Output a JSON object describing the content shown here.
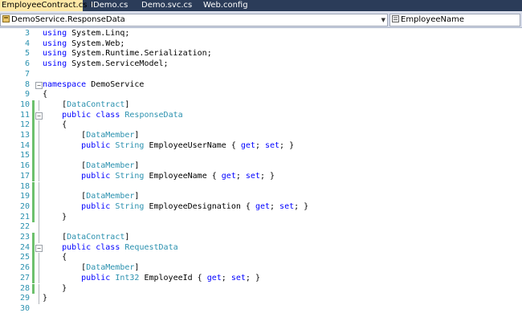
{
  "tabs": [
    {
      "label": "EmployeeContract.cs",
      "active": true,
      "closable": true
    },
    {
      "label": "IDemo.cs"
    },
    {
      "label": "Demo.svc.cs"
    },
    {
      "label": "Web.config"
    }
  ],
  "navbar": {
    "type_selector": {
      "value": "DemoService.ResponseData",
      "icon": "class-icon"
    },
    "member_selector": {
      "value": "EmployeeName",
      "icon": "property-icon"
    }
  },
  "colors": {
    "keyword": "#0000ff",
    "type": "#2b91af",
    "line_number": "#2b91af",
    "change_saved": "#6cc06c"
  },
  "code_lines": [
    {
      "num": "3",
      "tokens": [
        {
          "t": "using",
          "c": "kw"
        },
        {
          "t": " System.Linq;",
          "c": "pl"
        }
      ]
    },
    {
      "num": "4",
      "tokens": [
        {
          "t": "using",
          "c": "kw"
        },
        {
          "t": " System.Web;",
          "c": "pl"
        }
      ]
    },
    {
      "num": "5",
      "tokens": [
        {
          "t": "using",
          "c": "kw"
        },
        {
          "t": " System.Runtime.Serialization;",
          "c": "pl"
        }
      ]
    },
    {
      "num": "6",
      "tokens": [
        {
          "t": "using",
          "c": "kw"
        },
        {
          "t": " System.ServiceModel;",
          "c": "pl"
        }
      ]
    },
    {
      "num": "7",
      "tokens": []
    },
    {
      "num": "8",
      "fold": "−",
      "tokens": [
        {
          "t": "namespace",
          "c": "kw"
        },
        {
          "t": " DemoService",
          "c": "pl"
        }
      ]
    },
    {
      "num": "9",
      "tokens": [
        {
          "t": "{",
          "c": "pl"
        }
      ]
    },
    {
      "num": "10",
      "changed": true,
      "tokens": [
        {
          "t": "    [",
          "c": "pl"
        },
        {
          "t": "DataContract",
          "c": "typ"
        },
        {
          "t": "]",
          "c": "pl"
        }
      ]
    },
    {
      "num": "11",
      "changed": true,
      "fold": "−",
      "tokens": [
        {
          "t": "    public",
          "c": "kw"
        },
        {
          "t": " ",
          "c": "pl"
        },
        {
          "t": "class",
          "c": "kw"
        },
        {
          "t": " ",
          "c": "pl"
        },
        {
          "t": "ResponseData",
          "c": "typ"
        }
      ]
    },
    {
      "num": "12",
      "changed": true,
      "tokens": [
        {
          "t": "    {",
          "c": "pl"
        }
      ]
    },
    {
      "num": "13",
      "changed": true,
      "tokens": [
        {
          "t": "        [",
          "c": "pl"
        },
        {
          "t": "DataMember",
          "c": "typ"
        },
        {
          "t": "]",
          "c": "pl"
        }
      ]
    },
    {
      "num": "14",
      "changed": true,
      "tokens": [
        {
          "t": "        public",
          "c": "kw"
        },
        {
          "t": " ",
          "c": "pl"
        },
        {
          "t": "String",
          "c": "typ"
        },
        {
          "t": " EmployeeUserName { ",
          "c": "pl"
        },
        {
          "t": "get",
          "c": "kw"
        },
        {
          "t": "; ",
          "c": "pl"
        },
        {
          "t": "set",
          "c": "kw"
        },
        {
          "t": "; }",
          "c": "pl"
        }
      ]
    },
    {
      "num": "15",
      "changed": true,
      "tokens": []
    },
    {
      "num": "16",
      "changed": true,
      "tokens": [
        {
          "t": "        [",
          "c": "pl"
        },
        {
          "t": "DataMember",
          "c": "typ"
        },
        {
          "t": "]",
          "c": "pl"
        }
      ]
    },
    {
      "num": "17",
      "changed": true,
      "tokens": [
        {
          "t": "        public",
          "c": "kw"
        },
        {
          "t": " ",
          "c": "pl"
        },
        {
          "t": "String",
          "c": "typ"
        },
        {
          "t": " EmployeeName { ",
          "c": "pl"
        },
        {
          "t": "get",
          "c": "kw"
        },
        {
          "t": "; ",
          "c": "pl"
        },
        {
          "t": "set",
          "c": "kw"
        },
        {
          "t": "; }",
          "c": "pl"
        }
      ]
    },
    {
      "num": "18",
      "changed": true,
      "tokens": []
    },
    {
      "num": "19",
      "changed": true,
      "tokens": [
        {
          "t": "        [",
          "c": "pl"
        },
        {
          "t": "DataMember",
          "c": "typ"
        },
        {
          "t": "]",
          "c": "pl"
        }
      ]
    },
    {
      "num": "20",
      "changed": true,
      "tokens": [
        {
          "t": "        public",
          "c": "kw"
        },
        {
          "t": " ",
          "c": "pl"
        },
        {
          "t": "String",
          "c": "typ"
        },
        {
          "t": " EmployeeDesignation { ",
          "c": "pl"
        },
        {
          "t": "get",
          "c": "kw"
        },
        {
          "t": "; ",
          "c": "pl"
        },
        {
          "t": "set",
          "c": "kw"
        },
        {
          "t": "; }",
          "c": "pl"
        }
      ]
    },
    {
      "num": "21",
      "changed": true,
      "tokens": [
        {
          "t": "    }",
          "c": "pl"
        }
      ]
    },
    {
      "num": "22",
      "tokens": []
    },
    {
      "num": "23",
      "changed": true,
      "tokens": [
        {
          "t": "    [",
          "c": "pl"
        },
        {
          "t": "DataContract",
          "c": "typ"
        },
        {
          "t": "]",
          "c": "pl"
        }
      ]
    },
    {
      "num": "24",
      "changed": true,
      "fold": "−",
      "tokens": [
        {
          "t": "    public",
          "c": "kw"
        },
        {
          "t": " ",
          "c": "pl"
        },
        {
          "t": "class",
          "c": "kw"
        },
        {
          "t": " ",
          "c": "pl"
        },
        {
          "t": "RequestData",
          "c": "typ"
        }
      ]
    },
    {
      "num": "25",
      "changed": true,
      "tokens": [
        {
          "t": "    {",
          "c": "pl"
        }
      ]
    },
    {
      "num": "26",
      "changed": true,
      "tokens": [
        {
          "t": "        [",
          "c": "pl"
        },
        {
          "t": "DataMember",
          "c": "typ"
        },
        {
          "t": "]",
          "c": "pl"
        }
      ]
    },
    {
      "num": "27",
      "changed": true,
      "tokens": [
        {
          "t": "        public",
          "c": "kw"
        },
        {
          "t": " ",
          "c": "pl"
        },
        {
          "t": "Int32",
          "c": "typ"
        },
        {
          "t": " EmployeeId { ",
          "c": "pl"
        },
        {
          "t": "get",
          "c": "kw"
        },
        {
          "t": "; ",
          "c": "pl"
        },
        {
          "t": "set",
          "c": "kw"
        },
        {
          "t": "; }",
          "c": "pl"
        }
      ]
    },
    {
      "num": "28",
      "changed": true,
      "tokens": [
        {
          "t": "    }",
          "c": "pl"
        }
      ]
    },
    {
      "num": "29",
      "tokens": [
        {
          "t": "}",
          "c": "pl"
        }
      ]
    },
    {
      "num": "30",
      "tokens": []
    }
  ]
}
